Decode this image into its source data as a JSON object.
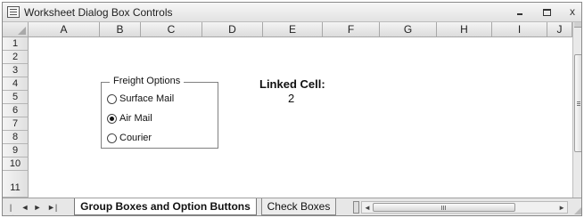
{
  "window": {
    "title": "Worksheet Dialog Box Controls",
    "close_glyph": "x"
  },
  "columns": [
    "A",
    "B",
    "C",
    "D",
    "E",
    "F",
    "G",
    "H",
    "I",
    "J"
  ],
  "rows": [
    "1",
    "2",
    "3",
    "4",
    "5",
    "6",
    "7",
    "8",
    "9",
    "10",
    "11"
  ],
  "group_box": {
    "caption": "Freight Options",
    "options": [
      {
        "label": "Surface Mail",
        "checked": false
      },
      {
        "label": "Air Mail",
        "checked": true
      },
      {
        "label": "Courier",
        "checked": false
      }
    ]
  },
  "linked_cell": {
    "label": "Linked Cell:",
    "value": "2"
  },
  "tabs": [
    {
      "label": "Group Boxes and Option Buttons",
      "active": true
    },
    {
      "label": "Check Boxes",
      "active": false
    }
  ],
  "tab_nav": {
    "first": "|◄",
    "prev": "◄",
    "next": "►",
    "last": "►|"
  },
  "icons": {
    "app": "sheet-icon",
    "minimize": "minimize-icon",
    "maximize": "maximize-icon",
    "close": "close-icon"
  }
}
